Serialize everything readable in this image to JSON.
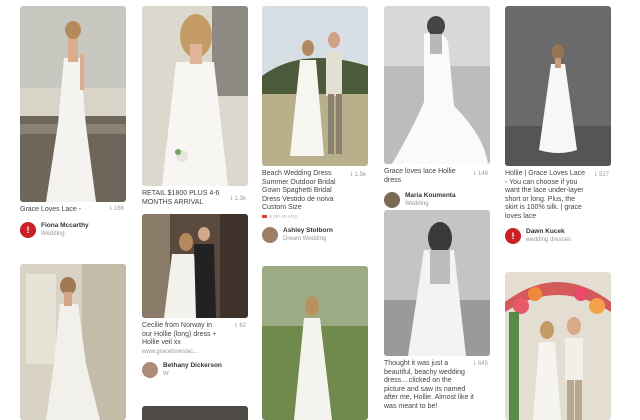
{
  "colors": {
    "brand": "#cb2027",
    "text": "#333333",
    "muted": "#999999"
  },
  "pins": [
    {
      "desc": "Grace Loves Lace -",
      "count": "186",
      "pinner": "Fiona Mccarthy",
      "board": "Wedding"
    },
    {
      "desc": "RETAIL $1800 PLUS 4-6 MONTHS ARRIVAL",
      "count": "1.3k",
      "pinner": "",
      "board": ""
    },
    {
      "desc": "Beach Wedding Dress Summer Outdoor Bridal Gown Spaghetti Bridal Dress Vestido de noiva Custom Size",
      "count": "1.5k",
      "via": "a pin on etsy",
      "pinner": "Ashley Stolborn",
      "board": "Dream Wedding"
    },
    {
      "desc": "Grace loves lace Hollie dress",
      "count": "146",
      "pinner": "Maria Koumenta",
      "board": "Wedding"
    },
    {
      "desc": "Hollie | Grace Loves Lace - You can choose if you want the lace under-layer short or long. Plus, the skirt is 100% silk. | grace loves lace",
      "count": "527",
      "pinner": "Dawn Kucek",
      "board": "wedding dresses"
    },
    {
      "desc": "",
      "count": "",
      "pinner": "",
      "board": ""
    },
    {
      "desc": "Cecilie from Norway in our Hollie (long) dress + Hollie veil xx",
      "count": "62",
      "link": "www.graceloveslac...",
      "pinner": "Bethany Dickerson",
      "board": "W"
    },
    {
      "desc": "",
      "count": "",
      "pinner": "",
      "board": ""
    },
    {
      "desc": "Thought it was just a beautiful, beachy wedding dress....clicked on the picture and saw its named after me, Hollie. Almost like it was meant to be!",
      "count": "645",
      "pinner": "",
      "board": ""
    },
    {
      "desc": "",
      "count": "",
      "pinner": "",
      "board": ""
    }
  ],
  "icons": {
    "pin": "pin-icon",
    "brand_avatar": "pinterest-logo-icon"
  }
}
